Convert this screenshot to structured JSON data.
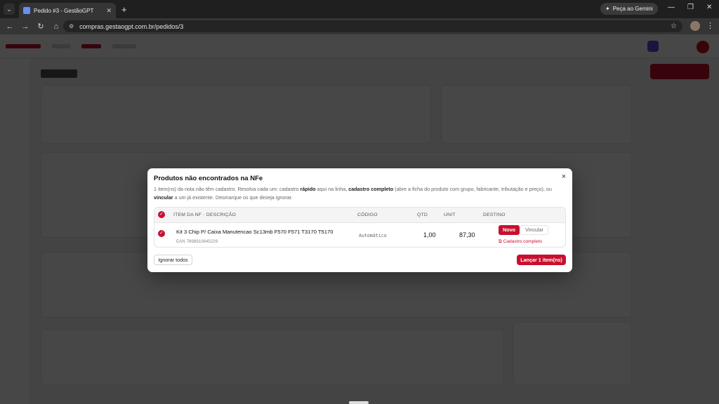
{
  "browser": {
    "tab_title": "Pedido #3 - GestãoGPT",
    "tab_close": "✕",
    "new_tab": "+",
    "gemini_label": "Peça ao Gemini",
    "url": "compras.gestaogpt.com.br/pedidos/3"
  },
  "modal": {
    "title": "Produtos não encontrados na NFe",
    "close": "×",
    "desc_1": "1 item(ns) da nota não têm cadastro. Resolva cada um: cadastro ",
    "desc_b1": "rápido",
    "desc_2": " aqui na linha, ",
    "desc_b2": "cadastro completo",
    "desc_3": " (abre a ficha do produto com grupo, fabricante, tributação e preço), ou ",
    "desc_b3": "vincular",
    "desc_4": " a um já existente. Desmarque os que deseja ignorar.",
    "headers": {
      "item": "ITEM DA NF · DESCRIÇÃO",
      "code": "CÓDIGO",
      "qty": "QTD",
      "unit": "UNIT",
      "dest": "DESTINO"
    },
    "row": {
      "name": "Kit 3 Chip P/ Caixa Manutencao Sc13mb F570 F571 T3170 T5170",
      "ean": "EAN 7898910645229",
      "code": "Automático",
      "qty": "1,00",
      "unit": "87,30",
      "novo": "Novo",
      "vincular": "Vincular",
      "cadastro": "Cadastro completo"
    },
    "ignore_all": "Ignorar todos",
    "launch": "Lançar 1 item(ns)"
  },
  "colors": {
    "accent": "#c8102e",
    "overlay": "rgba(0,0,0,0.72)"
  }
}
